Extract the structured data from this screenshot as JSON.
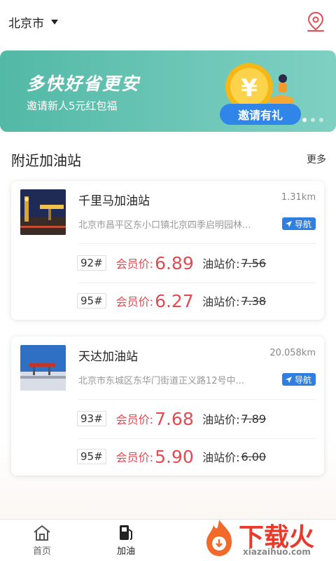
{
  "header": {
    "city": "北京市"
  },
  "banner": {
    "title": "多快好省更安",
    "subtitle": "邀请新人5元红包福",
    "badge": "邀请有礼",
    "coin_symbol": "¥"
  },
  "section": {
    "title": "附近加油站",
    "more": "更多"
  },
  "stations": [
    {
      "name": "千里马加油站",
      "distance": "1.31km",
      "address": "北京市昌平区东小口镇北京四季启明园林...",
      "nav": "导航",
      "prices": [
        {
          "grade": "92#",
          "member_label": "会员价:",
          "member_price": "6.89",
          "station_label": "油站价:",
          "station_price": "7.56"
        },
        {
          "grade": "95#",
          "member_label": "会员价:",
          "member_price": "6.27",
          "station_label": "油站价:",
          "station_price": "7.38"
        }
      ]
    },
    {
      "name": "天达加油站",
      "distance": "20.058km",
      "address": "北京市东城区东华门街道正义路12号中...",
      "nav": "导航",
      "prices": [
        {
          "grade": "93#",
          "member_label": "会员价:",
          "member_price": "7.68",
          "station_label": "油站价:",
          "station_price": "7.89"
        },
        {
          "grade": "95#",
          "member_label": "会员价:",
          "member_price": "5.90",
          "station_label": "油站价:",
          "station_price": "6.00"
        }
      ]
    }
  ],
  "tabs": [
    {
      "label": "首页",
      "icon": "home-icon"
    },
    {
      "label": "加油",
      "icon": "fuel-pump-icon"
    }
  ],
  "watermark": {
    "text": "下载火",
    "url": "xiazaihuo.com"
  },
  "colors": {
    "accent_red": "#e14b52",
    "banner_teal": "#5bbcaa",
    "nav_blue": "#2f7fe0"
  }
}
